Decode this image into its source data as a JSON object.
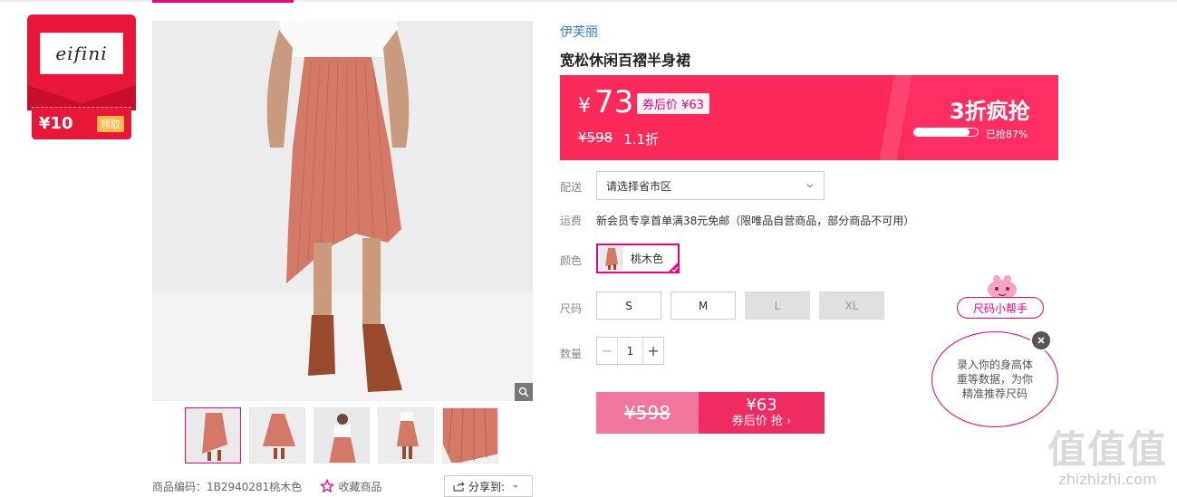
{
  "brand_card": {
    "logo_text": "eifini",
    "coupon_amount": "¥10",
    "coupon_button": "领取"
  },
  "gallery": {
    "thumbnails": [
      "thumb-1",
      "thumb-2",
      "thumb-3",
      "thumb-4",
      "thumb-5"
    ],
    "product_code_label": "商品编码：1B2940281桃木色",
    "favorite_label": "收藏商品",
    "share_label": "分享到:"
  },
  "product": {
    "brand": "伊芙丽",
    "title": "宽松休闲百褶半身裙"
  },
  "price": {
    "currency": "¥",
    "current": "73",
    "after_coupon_tag": "券后价 ¥63",
    "original": "¥598",
    "discount": "1.1折",
    "flash_title": "3折疯抢",
    "sold_progress": 0.87,
    "sold_label": "已抢87%"
  },
  "delivery": {
    "label": "配送",
    "placeholder": "请选择省市区"
  },
  "shipping": {
    "label": "运费",
    "text": "新会员专享首单满38元免邮（限唯品自营商品，部分商品不可用）"
  },
  "color": {
    "label": "颜色",
    "selected": "桃木色"
  },
  "size": {
    "label": "尺码",
    "options": [
      {
        "label": "S",
        "available": true
      },
      {
        "label": "M",
        "available": true
      },
      {
        "label": "L",
        "available": false
      },
      {
        "label": "XL",
        "available": false
      }
    ]
  },
  "quantity": {
    "label": "数量",
    "value": "1",
    "minus": "−",
    "plus": "+"
  },
  "buy": {
    "original": "¥598",
    "after_price": "¥63",
    "after_label": "券后价 抢 ›"
  },
  "size_helper": {
    "tag": "尺码小帮手",
    "text": "录入你的身高体重等数据，为你精准推荐尺码"
  },
  "watermark": {
    "big": "值值值",
    "small": "zhizhizhi.com"
  },
  "colors": {
    "accent": "#f10180",
    "price_bg": "#ff2e62",
    "link": "#2b7bd3"
  }
}
